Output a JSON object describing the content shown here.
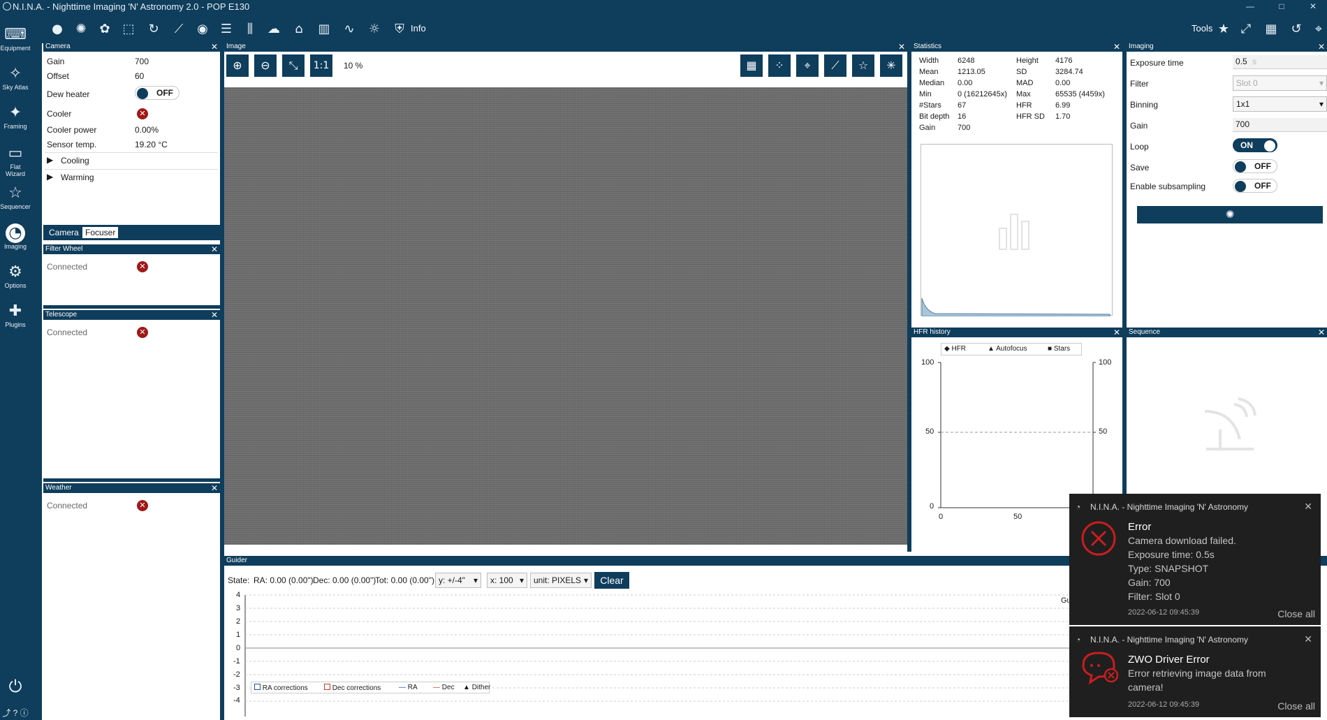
{
  "titlebar": {
    "title": "N.I.N.A. - Nighttime Imaging 'N' Astronomy 2.0   -  POP E130"
  },
  "toolbar": {
    "info_label": "Info",
    "tools_label": "Tools"
  },
  "sidebar": {
    "items": [
      {
        "label": "Equipment"
      },
      {
        "label": "Sky Atlas"
      },
      {
        "label": "Framing"
      },
      {
        "label": "Flat Wizard"
      },
      {
        "label": "Sequencer"
      },
      {
        "label": "Imaging"
      },
      {
        "label": "Options"
      },
      {
        "label": "Plugins"
      }
    ]
  },
  "camera_panel": {
    "title": "Camera",
    "gain_label": "Gain",
    "gain": "700",
    "offset_label": "Offset",
    "offset": "60",
    "dew_label": "Dew heater",
    "dew_state": "OFF",
    "cooler_label": "Cooler",
    "cooler_power_label": "Cooler power",
    "cooler_power": "0.00%",
    "sensor_label": "Sensor temp.",
    "sensor": "19.20 °C",
    "cooling": "Cooling",
    "warming": "Warming",
    "tab_camera": "Camera",
    "tab_focuser": "Focuser"
  },
  "filter_wheel": {
    "title": "Filter Wheel",
    "connected": "Connected"
  },
  "telescope": {
    "title": "Telescope",
    "connected": "Connected"
  },
  "weather": {
    "title": "Weather",
    "connected": "Connected"
  },
  "image_panel": {
    "title": "Image",
    "ratio": "1:1",
    "zoom": "10 %"
  },
  "statistics": {
    "title": "Statistics",
    "width_label": "Width",
    "width": "6248",
    "height_label": "Height",
    "height": "4176",
    "mean_label": "Mean",
    "mean": "1213.05",
    "sd_label": "SD",
    "sd": "3284.74",
    "median_label": "Median",
    "median": "0.00",
    "mad_label": "MAD",
    "mad": "0.00",
    "min_label": "Min",
    "min": "0 (16212645x)",
    "max_label": "Max",
    "max": "65535 (4459x)",
    "stars_label": "#Stars",
    "stars": "67",
    "hfr_label": "HFR",
    "hfr": "6.99",
    "bitdepth_label": "Bit depth",
    "bitdepth": "16",
    "hfrsd_label": "HFR SD",
    "hfrsd": "1.70",
    "gain_label": "Gain",
    "gain": "700"
  },
  "imaging": {
    "title": "Imaging",
    "exposure_label": "Exposure time",
    "exposure": "0.5",
    "exposure_unit": "s",
    "filter_label": "Filter",
    "filter": "Slot 0",
    "binning_label": "Binning",
    "binning": "1x1",
    "gain_label": "Gain",
    "gain": "700",
    "loop_label": "Loop",
    "loop_state": "ON",
    "save_label": "Save",
    "save_state": "OFF",
    "subsampling_label": "Enable subsampling",
    "subsampling_state": "OFF"
  },
  "hfr_history": {
    "title": "HFR history",
    "legend": [
      "HFR",
      "Autofocus",
      "Stars"
    ],
    "y_ticks": [
      "100",
      "50",
      "0"
    ],
    "x_ticks": [
      "0",
      "50"
    ]
  },
  "sequence": {
    "title": "Sequence"
  },
  "guider": {
    "title": "Guider",
    "state": "State:",
    "ra": "RA: 0.00 (0.00\")",
    "dec": "Dec: 0.00 (0.00\")",
    "tot": "Tot: 0.00 (0.00\")",
    "y_select": "y: +/-4\"",
    "x_select": "x: 100",
    "unit_select": "unit: PIXELS",
    "clear": "Clear",
    "y_ticks": [
      "4",
      "3",
      "2",
      "1",
      "0",
      "-1",
      "-2",
      "-3",
      "-4"
    ],
    "legend": [
      "RA corrections",
      "Dec corrections",
      "RA",
      "Dec",
      "Dither"
    ],
    "right_label": "Gu"
  },
  "toasts": [
    {
      "app": "N.I.N.A. - Nighttime Imaging 'N' Astronomy",
      "title": "Error",
      "lines": [
        "Camera download failed.",
        "Exposure time: 0.5s",
        "Type: SNAPSHOT",
        "Gain: 700",
        "Filter: Slot 0"
      ],
      "time": "2022-06-12 09:45:39",
      "close_all": "Close all"
    },
    {
      "app": "N.I.N.A. - Nighttime Imaging 'N' Astronomy",
      "title": "ZWO Driver Error",
      "lines": [
        "Error retrieving image data from",
        "camera!"
      ],
      "time": "2022-06-12 09:45:39",
      "close_all": "Close all"
    }
  ],
  "colors": {
    "accent": "#0f3d5c",
    "error": "#c81e1e",
    "toast_bg": "#1f1f1f"
  },
  "icons": [
    "camera-icon",
    "telescope-icon",
    "filter-wheel-icon",
    "focuser-icon",
    "rotator-icon",
    "weather-icon",
    "dome-icon",
    "switch-icon",
    "guider-icon",
    "flat-panel-icon",
    "safety-monitor-icon"
  ]
}
